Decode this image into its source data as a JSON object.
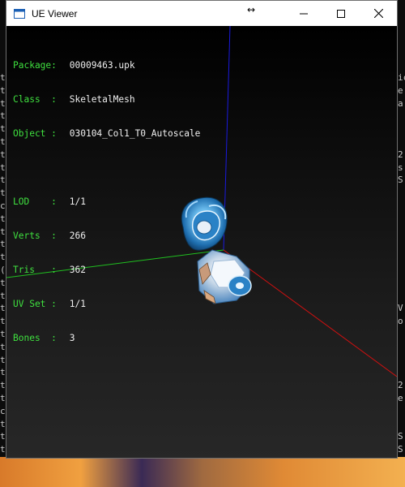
{
  "window": {
    "title": "UE Viewer",
    "resize_icon": "↔",
    "controls": [
      "minimize-icon",
      "maximize-icon",
      "close-icon"
    ]
  },
  "info_panel": {
    "group1": [
      {
        "label": "Package:",
        "value": "00009463.upk"
      },
      {
        "label": "Class  :",
        "value": "SkeletalMesh"
      },
      {
        "label": "Object :",
        "value": "030104_Col1_T0_Autoscale"
      }
    ],
    "group2": [
      {
        "label": "LOD    :",
        "value": "1/1"
      },
      {
        "label": "Verts  :",
        "value": "266"
      },
      {
        "label": "Tris   :",
        "value": "362"
      },
      {
        "label": "UV Set :",
        "value": "1/1"
      },
      {
        "label": "Bones  :",
        "value": "3"
      }
    ]
  },
  "scene": {
    "axis_colors": {
      "x": "#d01010",
      "y": "#20c020",
      "z": "#1a1ae0"
    },
    "mesh_color": "#3a9ad8"
  },
  "background": {
    "left_strip": [
      "t",
      "t",
      "t",
      "t",
      "t",
      "t",
      "t",
      "t",
      "t",
      "t",
      "c",
      "t",
      "t",
      "t",
      "t",
      "(",
      "t",
      "t",
      "t",
      "t",
      "t",
      "t",
      "t",
      "t",
      "t",
      "t",
      "c",
      "t",
      "t",
      "t"
    ],
    "right_strip": [
      "ic",
      "e",
      "a",
      "",
      "",
      "",
      "2",
      "s",
      "S",
      "",
      "",
      "",
      "",
      "",
      "",
      "",
      "",
      "",
      "V",
      "o",
      "",
      "",
      "",
      "",
      "2",
      "e",
      "",
      "",
      "S",
      "S",
      "S"
    ]
  }
}
